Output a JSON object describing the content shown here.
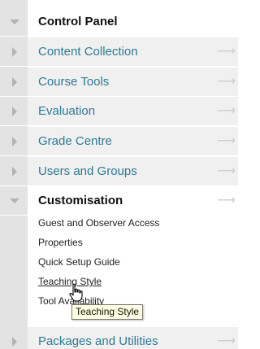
{
  "panel": {
    "header": {
      "label": "Control Panel"
    },
    "items": [
      {
        "label": "Content Collection"
      },
      {
        "label": "Course Tools"
      },
      {
        "label": "Evaluation"
      },
      {
        "label": "Grade Centre"
      },
      {
        "label": "Users and Groups"
      }
    ],
    "customisation": {
      "label": "Customisation",
      "sub_items": [
        {
          "label": "Guest and Observer Access"
        },
        {
          "label": "Properties"
        },
        {
          "label": "Quick Setup Guide"
        },
        {
          "label": "Teaching Style"
        },
        {
          "label": "Tool Availability"
        }
      ]
    },
    "packages": {
      "label": "Packages and Utilities"
    },
    "arrow_glyph": "⟶"
  },
  "tooltip": {
    "text": "Teaching Style"
  },
  "colors": {
    "link": "#2d7a93",
    "gutter": "#e3e3e3",
    "row_bg": "#f0f0f0",
    "tooltip_bg": "#ffffe1"
  }
}
